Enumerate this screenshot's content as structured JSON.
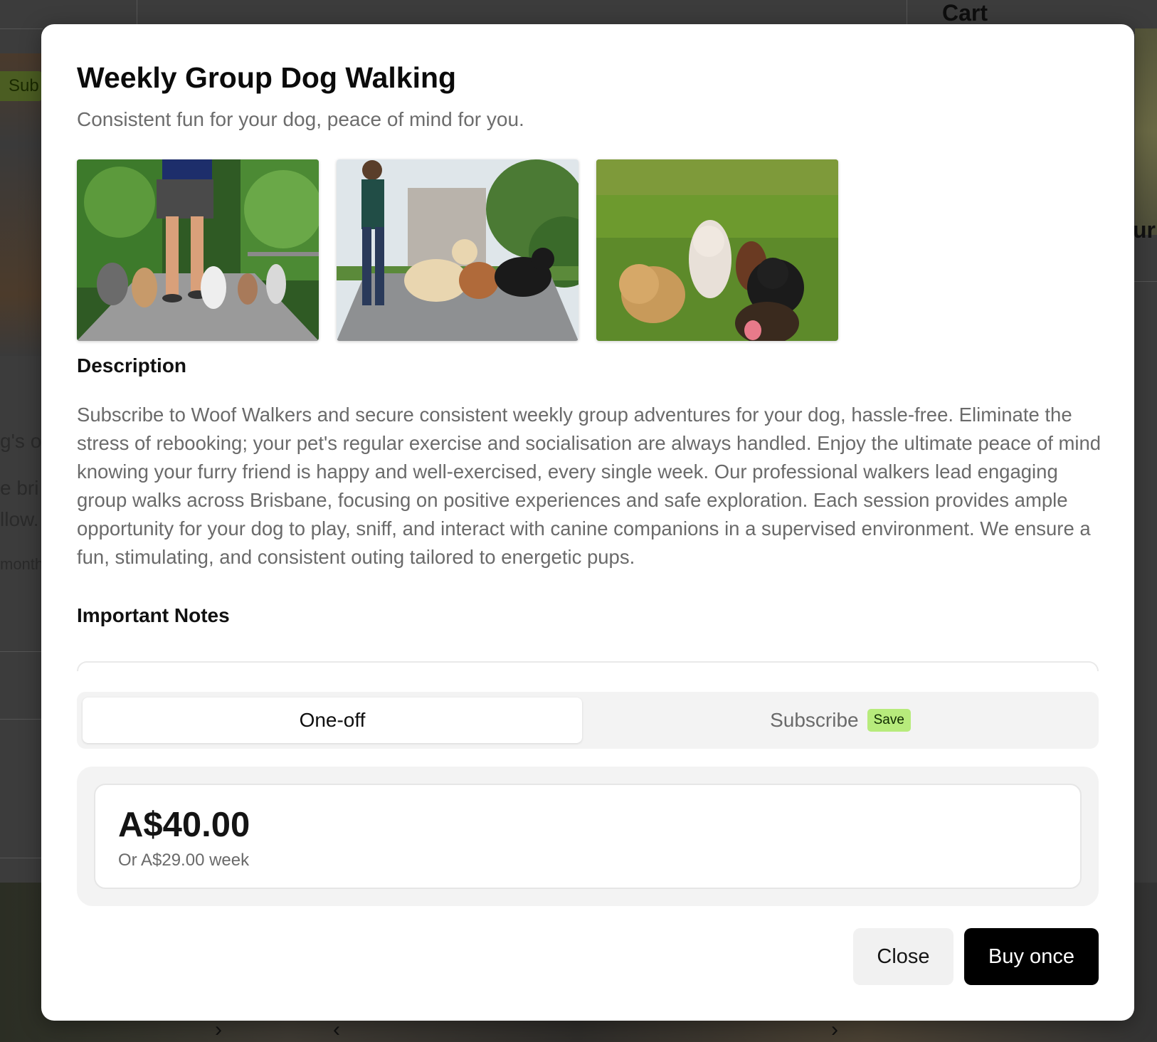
{
  "background": {
    "cart_label": "Cart",
    "badge_fragment": "Sub",
    "text_fragments": [
      "g's o",
      "e bri",
      "llow.",
      "month"
    ],
    "right_fragment": "ur"
  },
  "modal": {
    "title": "Weekly Group Dog Walking",
    "subtitle": "Consistent fun for your dog, peace of mind for you.",
    "gallery": [
      {
        "icon": "dogs-walking-park-photo"
      },
      {
        "icon": "woman-walking-dogs-photo"
      },
      {
        "icon": "dogs-on-grass-photo"
      }
    ],
    "description_heading": "Description",
    "description": "Subscribe to Woof Walkers and secure consistent weekly group adventures for your dog, hassle-free. Eliminate the stress of rebooking; your pet's regular exercise and socialisation are always handled. Enjoy the ultimate peace of mind knowing your furry friend is happy and well-exercised, every single week. Our professional walkers lead engaging group walks across Brisbane, focusing on positive experiences and safe exploration. Each session provides ample opportunity for your dog to play, sniff, and interact with canine companions in a supervised environment. We ensure a fun, stimulating, and consistent outing tailored to energetic pups.",
    "notes_heading": "Important Notes",
    "purchase_toggle": {
      "one_off_label": "One-off",
      "subscribe_label": "Subscribe",
      "save_badge": "Save",
      "selected": "One-off"
    },
    "price": {
      "main": "A$40.00",
      "alternative": "Or A$29.00 week"
    },
    "buttons": {
      "close_label": "Close",
      "buy_label": "Buy once"
    },
    "colors": {
      "save_badge_bg": "#b7eb7c",
      "primary_button": "#000000"
    }
  }
}
